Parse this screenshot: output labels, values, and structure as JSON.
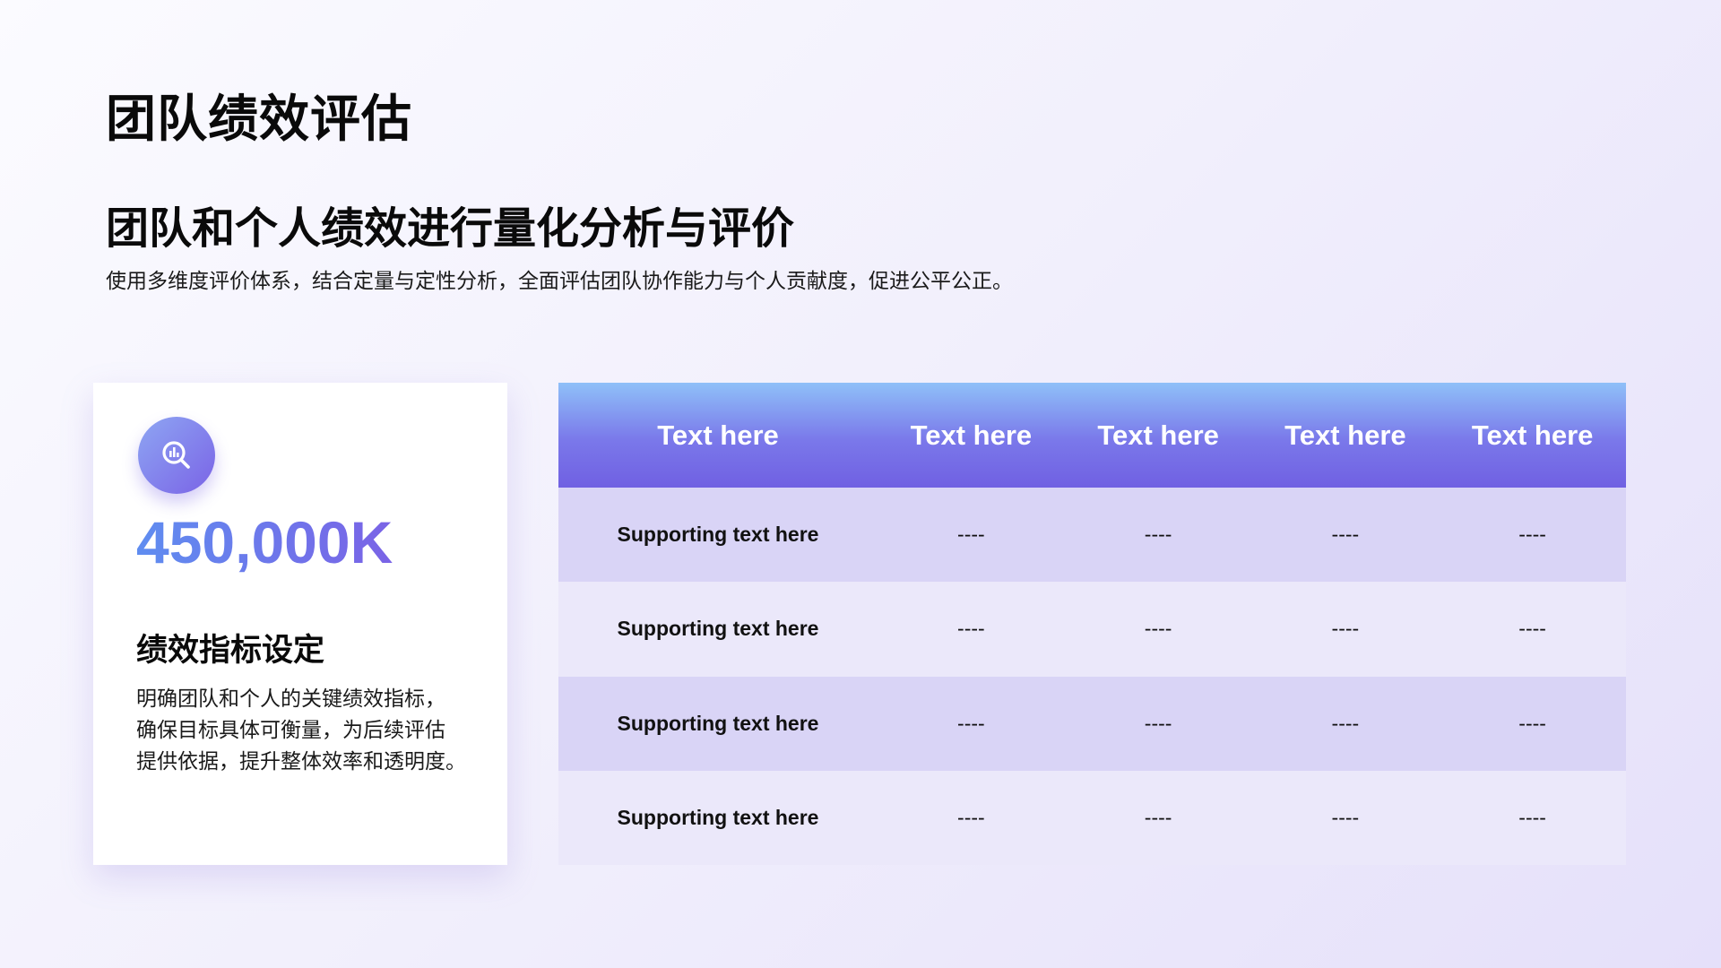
{
  "page": {
    "title": "团队绩效评估",
    "subtitle": "团队和个人绩效进行量化分析与评价",
    "description": "使用多维度评价体系，结合定量与定性分析，全面评估团队协作能力与个人贡献度，促进公平公正。"
  },
  "card": {
    "icon": "analytics-search-icon",
    "number": "450,000K",
    "heading": "绩效指标设定",
    "body_lines": [
      "明确团队和个人的关键绩效指标，",
      "确保目标具体可衡量，为后续评估",
      "提供依据，提升整体效率和透明度。"
    ]
  },
  "table": {
    "headers": [
      "Text here",
      "Text here",
      "Text here",
      "Text here",
      "Text here"
    ],
    "rows": [
      [
        "Supporting text here",
        "----",
        "----",
        "----",
        "----"
      ],
      [
        "Supporting text here",
        "----",
        "----",
        "----",
        "----"
      ],
      [
        "Supporting text here",
        "----",
        "----",
        "----",
        "----"
      ],
      [
        "Supporting text here",
        "----",
        "----",
        "----",
        "----"
      ]
    ]
  },
  "colors": {
    "accent_start": "#8ea6f3",
    "accent_end": "#7060e2",
    "row_odd": "#d9d4f6",
    "row_even": "#ebe8fa"
  }
}
